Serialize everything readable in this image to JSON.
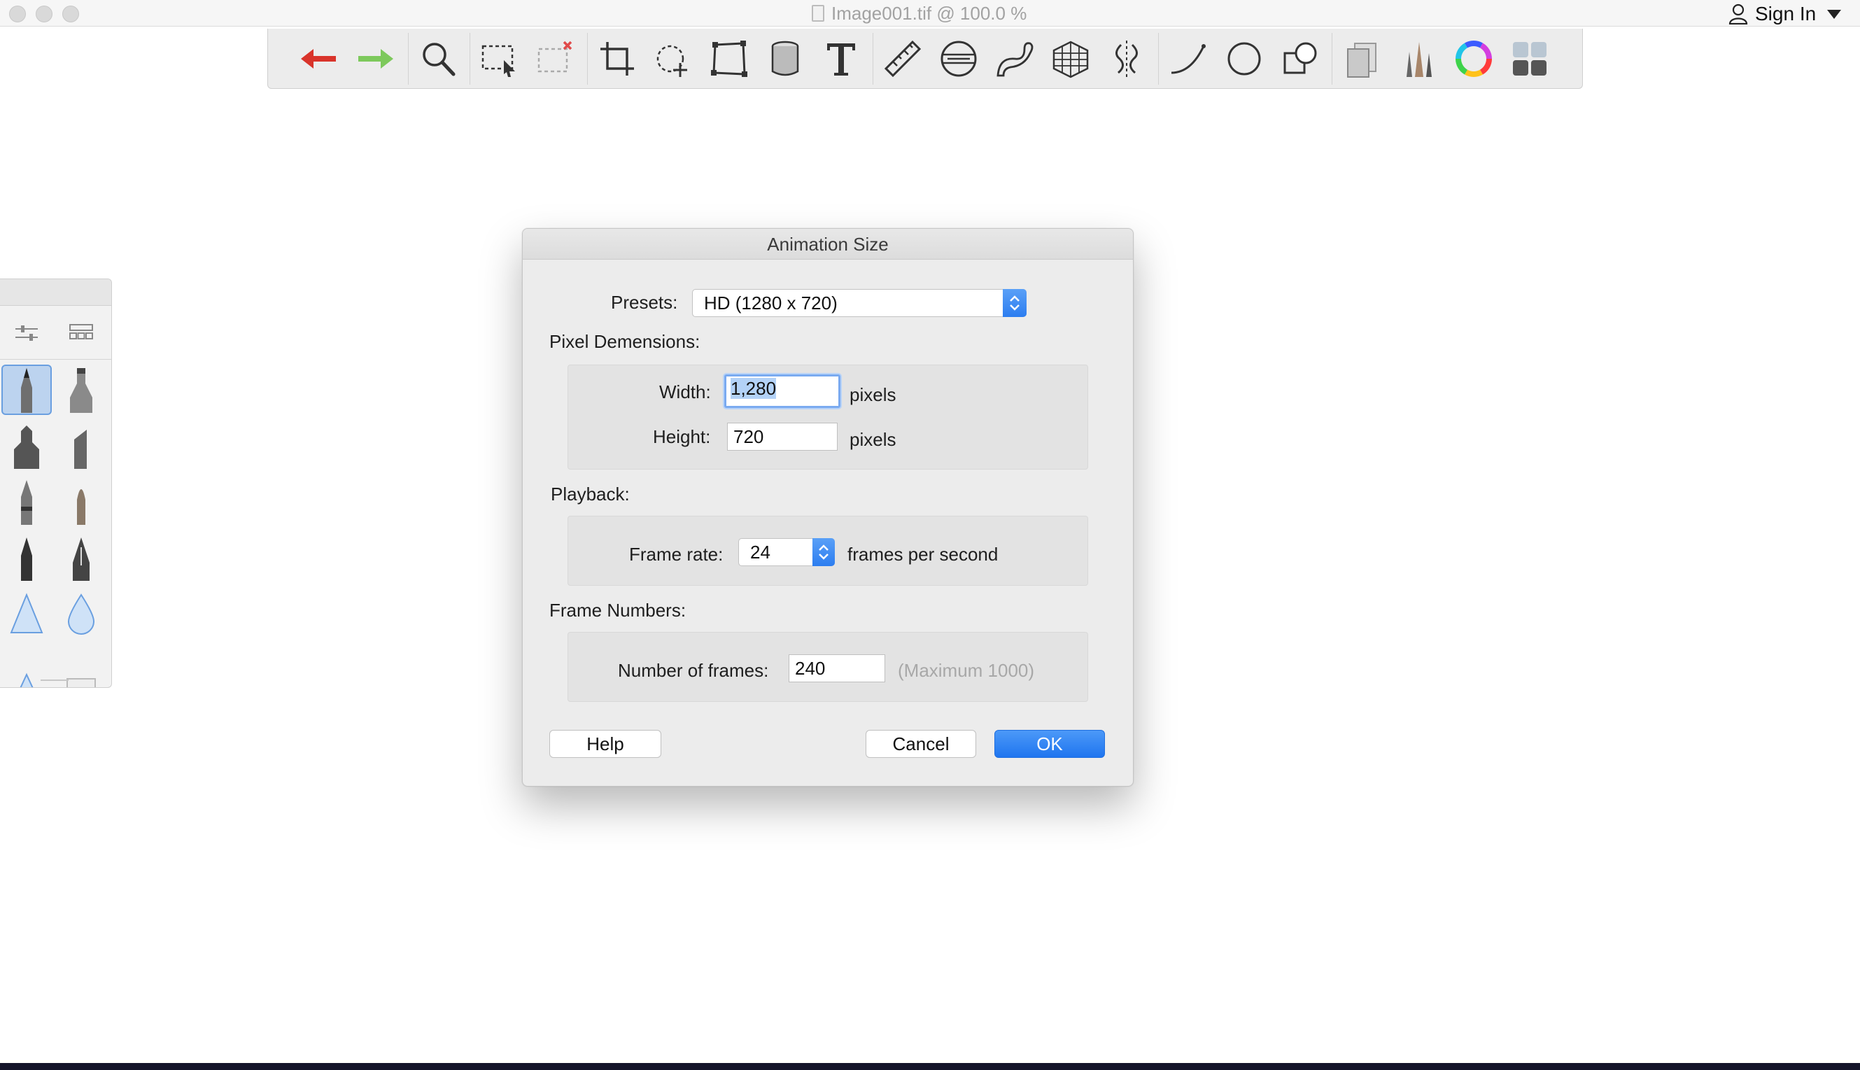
{
  "window": {
    "title": "Image001.tif @ 100.0 %",
    "sign_in": "Sign In"
  },
  "toolbar": {
    "icons": [
      "undo-icon",
      "redo-icon",
      "zoom-icon",
      "select-rect-icon",
      "deselect-icon",
      "crop-icon",
      "lasso-transform-icon",
      "distort-transform-icon",
      "fill-bucket-icon",
      "text-icon",
      "ruler-icon",
      "ellipse-guide-icon",
      "french-curve-icon",
      "perspective-grid-icon",
      "symmetry-icon",
      "stroke-icon",
      "ellipse-shape-icon",
      "shapes-icon",
      "copy-layers-icon",
      "brush-library-icon",
      "color-wheel-icon",
      "layers-grid-icon"
    ]
  },
  "dialog": {
    "title": "Animation Size",
    "presets_label": "Presets:",
    "presets_value": "HD (1280 x 720)",
    "pixel_dimensions_label": "Pixel Demensions:",
    "width_label": "Width:",
    "width_value": "1,280",
    "height_label": "Height:",
    "height_value": "720",
    "pixels_unit": "pixels",
    "playback_label": "Playback:",
    "frame_rate_label": "Frame rate:",
    "frame_rate_value": "24",
    "fps_unit": "frames per second",
    "frame_numbers_label": "Frame Numbers:",
    "num_frames_label": "Number of frames:",
    "num_frames_value": "240",
    "max_hint": "(Maximum 1000)",
    "help": "Help",
    "cancel": "Cancel",
    "ok": "OK"
  },
  "colors": {
    "accent": "#2c7df0",
    "undo": "#d9342b",
    "redo": "#6cc04a"
  }
}
